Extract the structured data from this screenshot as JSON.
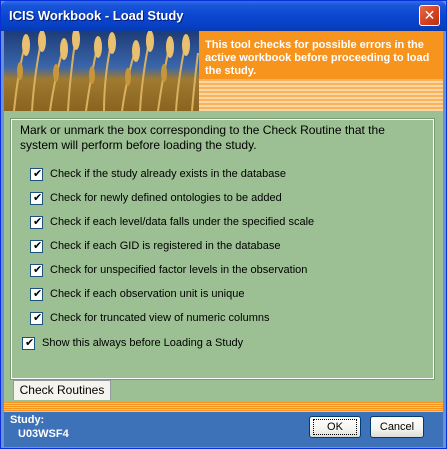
{
  "window": {
    "title": "ICIS Workbook - Load Study",
    "close_glyph": "✕"
  },
  "banner": {
    "message": "This tool checks for possible errors in the active workbook before proceeding to load the study.",
    "image": "wheat-field-image"
  },
  "panel": {
    "instructions": "Mark or unmark the box corresponding to the Check Routine that the system will perform before loading the study.",
    "checks": [
      {
        "label": "Check if the study already exists in the database",
        "checked": true
      },
      {
        "label": "Check for newly defined ontologies to be added",
        "checked": true
      },
      {
        "label": "Check if each level/data falls under the specified scale",
        "checked": true
      },
      {
        "label": "Check if each GID is registered in the database",
        "checked": true
      },
      {
        "label": "Check for unspecified factor levels in the observation",
        "checked": true
      },
      {
        "label": "Check if each observation unit is unique",
        "checked": true
      },
      {
        "label": "Check for truncated view of numeric columns",
        "checked": true
      }
    ],
    "show_always": {
      "label": "Show this always before Loading a Study",
      "checked": true
    }
  },
  "tab": {
    "label": "Check Routines"
  },
  "footer": {
    "study_label": "Study:",
    "study_value": "U03WSF4",
    "ok_label": "OK",
    "cancel_label": "Cancel"
  },
  "colors": {
    "panel_bg": "#9cc093",
    "banner_orange": "#f7941d",
    "footer_blue": "#3d72b8"
  }
}
